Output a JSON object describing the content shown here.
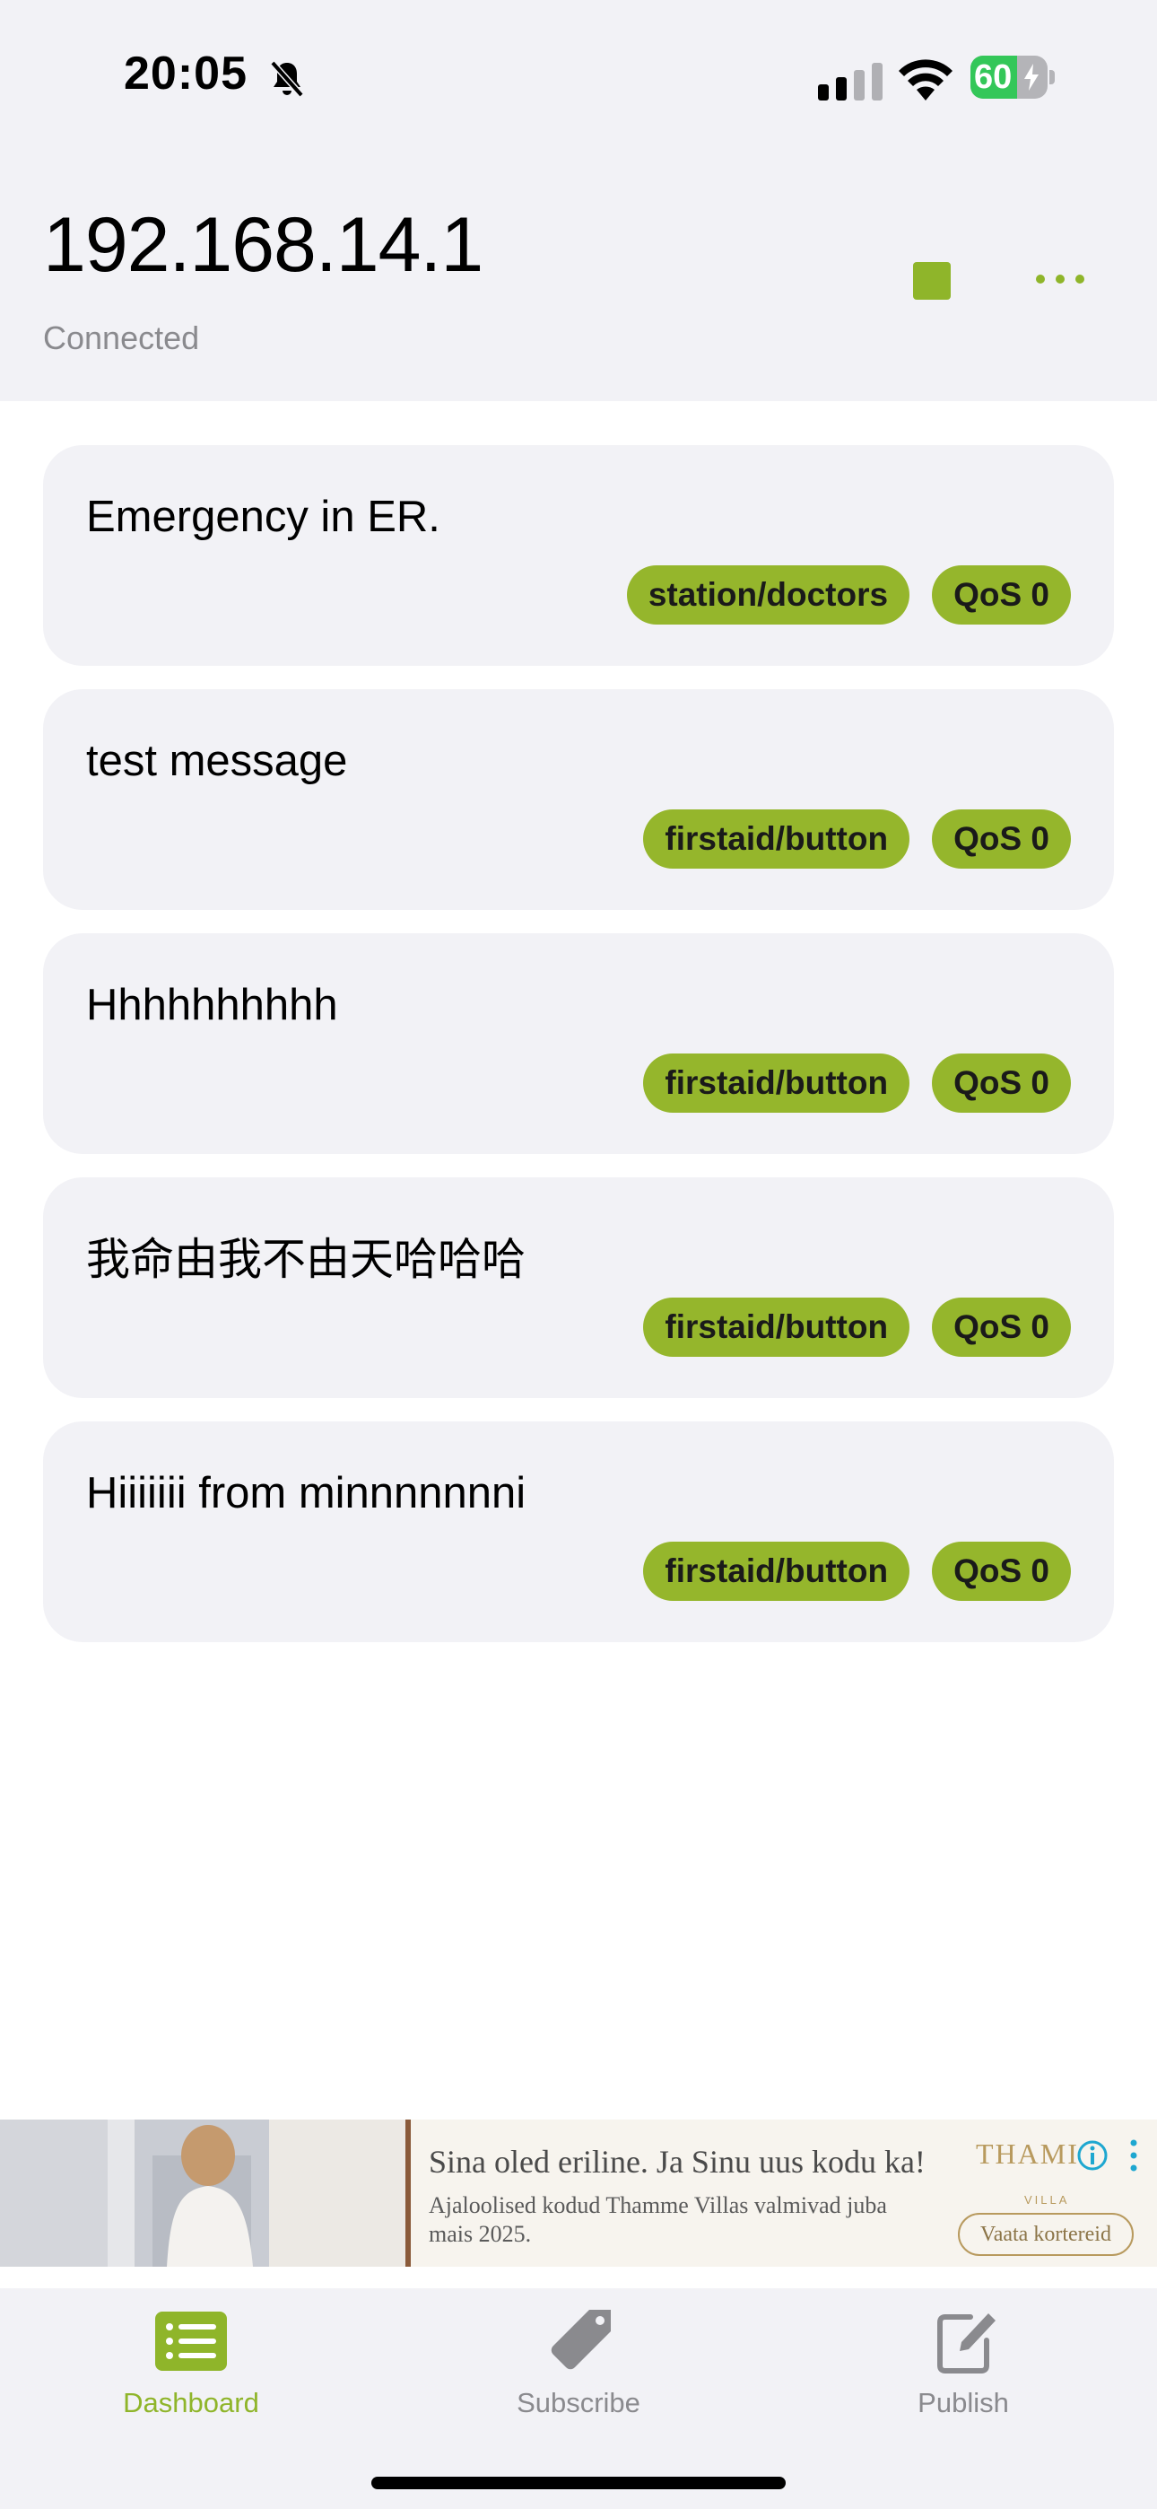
{
  "status_bar": {
    "time": "20:05",
    "battery": "60",
    "battery_level_percent": 60
  },
  "header": {
    "title": "192.168.14.1",
    "status": "Connected"
  },
  "messages": [
    {
      "text": "Emergency in ER.",
      "topic": "station/doctors",
      "qos": "QoS 0"
    },
    {
      "text": "test message",
      "topic": "firstaid/button",
      "qos": "QoS 0"
    },
    {
      "text": "Hhhhhhhhhh",
      "topic": "firstaid/button",
      "qos": "QoS 0"
    },
    {
      "text": "我命由我不由天哈哈哈",
      "topic": "firstaid/button",
      "qos": "QoS 0"
    },
    {
      "text": "Hiiiiiii from minnnnnnni",
      "topic": "firstaid/button",
      "qos": "QoS 0"
    }
  ],
  "ad": {
    "headline": "Sina oled eriline. Ja Sinu uus kodu ka!",
    "body": "Ajaloolised kodud Thamme Villas valmivad juba mais 2025.",
    "brand": "THAMI",
    "brand_sub": "VILLA",
    "cta": "Vaata kortereid"
  },
  "tabs": [
    {
      "label": "Dashboard",
      "icon": "list-icon"
    },
    {
      "label": "Subscribe",
      "icon": "tag-icon"
    },
    {
      "label": "Publish",
      "icon": "compose-icon"
    }
  ],
  "colors": {
    "accent": "#8fb52a",
    "tag_bg": "#95b62c",
    "card_bg": "#f2f2f6",
    "secondary_text": "#8a8a8e"
  }
}
